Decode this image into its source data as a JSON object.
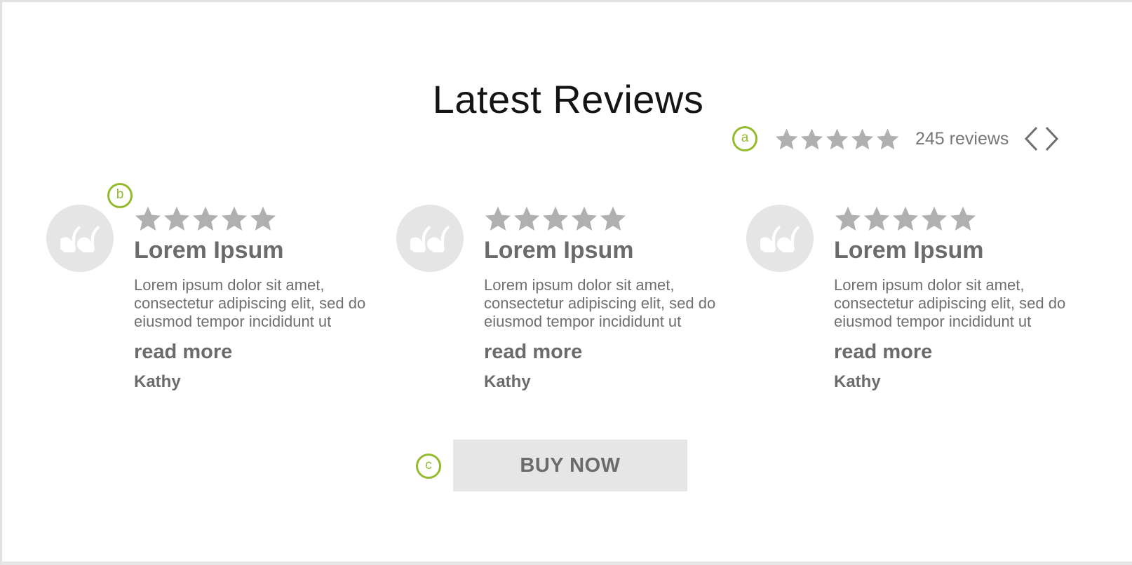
{
  "header": {
    "title": "Latest Reviews"
  },
  "summary": {
    "marker": "a",
    "rating": 5,
    "max_rating": 5,
    "review_count": "245 reviews",
    "prev_icon": "chevron-left-icon",
    "next_icon": "chevron-right-icon"
  },
  "markers": {
    "b": "b",
    "c": "c"
  },
  "reviews": [
    {
      "rating": 5,
      "title": "Lorem Ipsum",
      "text": "Lorem ipsum dolor sit amet, consectetur adipiscing elit, sed do eiusmod tempor incididunt ut",
      "link": "read more",
      "author": "Kathy"
    },
    {
      "rating": 5,
      "title": "Lorem Ipsum",
      "text": "Lorem ipsum dolor sit amet, consectetur adipiscing elit, sed do eiusmod tempor incididunt ut",
      "link": "read more",
      "author": "Kathy"
    },
    {
      "rating": 5,
      "title": "Lorem Ipsum",
      "text": "Lorem ipsum dolor sit amet, consectetur adipiscing elit, sed do eiusmod tempor incididunt ut",
      "link": "read more",
      "author": "Kathy"
    }
  ],
  "cta": {
    "label": "BUY NOW"
  },
  "colors": {
    "accent": "#94bb2e",
    "star": "#b0b0b0",
    "quote_badge": "#e5e5e5",
    "button_bg": "#e6e6e6",
    "text": "#6b6b6b",
    "title": "#141414"
  },
  "icons": {
    "star": "star-icon",
    "quote": "quote-icon"
  }
}
